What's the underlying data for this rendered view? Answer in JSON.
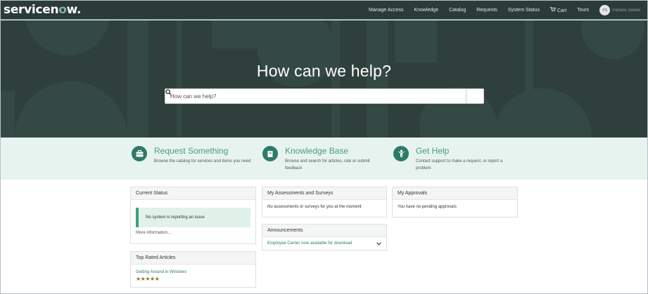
{
  "brand": {
    "logo_text_a": "servicen",
    "logo_text_o": "o",
    "logo_text_b": "w."
  },
  "nav": {
    "items": [
      "Manage Access",
      "Knowledge",
      "Catalog",
      "Requests",
      "System Status",
      "Cart",
      "Tours"
    ],
    "cart_icon": "cart-icon",
    "avatar_initials": "PS",
    "user_name": "Pamela Sewell"
  },
  "hero": {
    "title": "How can we help?",
    "search_placeholder": "How can we help?",
    "search_icon": "search-icon"
  },
  "quick_links": [
    {
      "icon": "briefcase-icon",
      "title": "Request Something",
      "desc": "Browse the catalog for services and items you need"
    },
    {
      "icon": "book-icon",
      "title": "Knowledge Base",
      "desc": "Browse and search for articles, rate or submit feedback"
    },
    {
      "icon": "person-help-icon",
      "title": "Get Help",
      "desc": "Contact support to make a request, or report a problem"
    }
  ],
  "current_status": {
    "title": "Current Status",
    "message": "No system is reporting an issue",
    "more": "More information..."
  },
  "top_rated": {
    "title": "Top Rated Articles",
    "article": "Getting Around in Windows",
    "rating": 5,
    "stars": "★★★★★"
  },
  "assessments": {
    "title": "My Assessments and Surveys",
    "message": "No assessments or surveys for you at the moment"
  },
  "announcements": {
    "title": "Announcements",
    "item": "Employee Center now available for download"
  },
  "approvals": {
    "title": "My Approvals",
    "message": "You have no pending approvals"
  },
  "colors": {
    "topbar": "#2b3b37",
    "hero": "#2f403c",
    "accent": "#2e7a68",
    "band": "#e7f3ef"
  }
}
